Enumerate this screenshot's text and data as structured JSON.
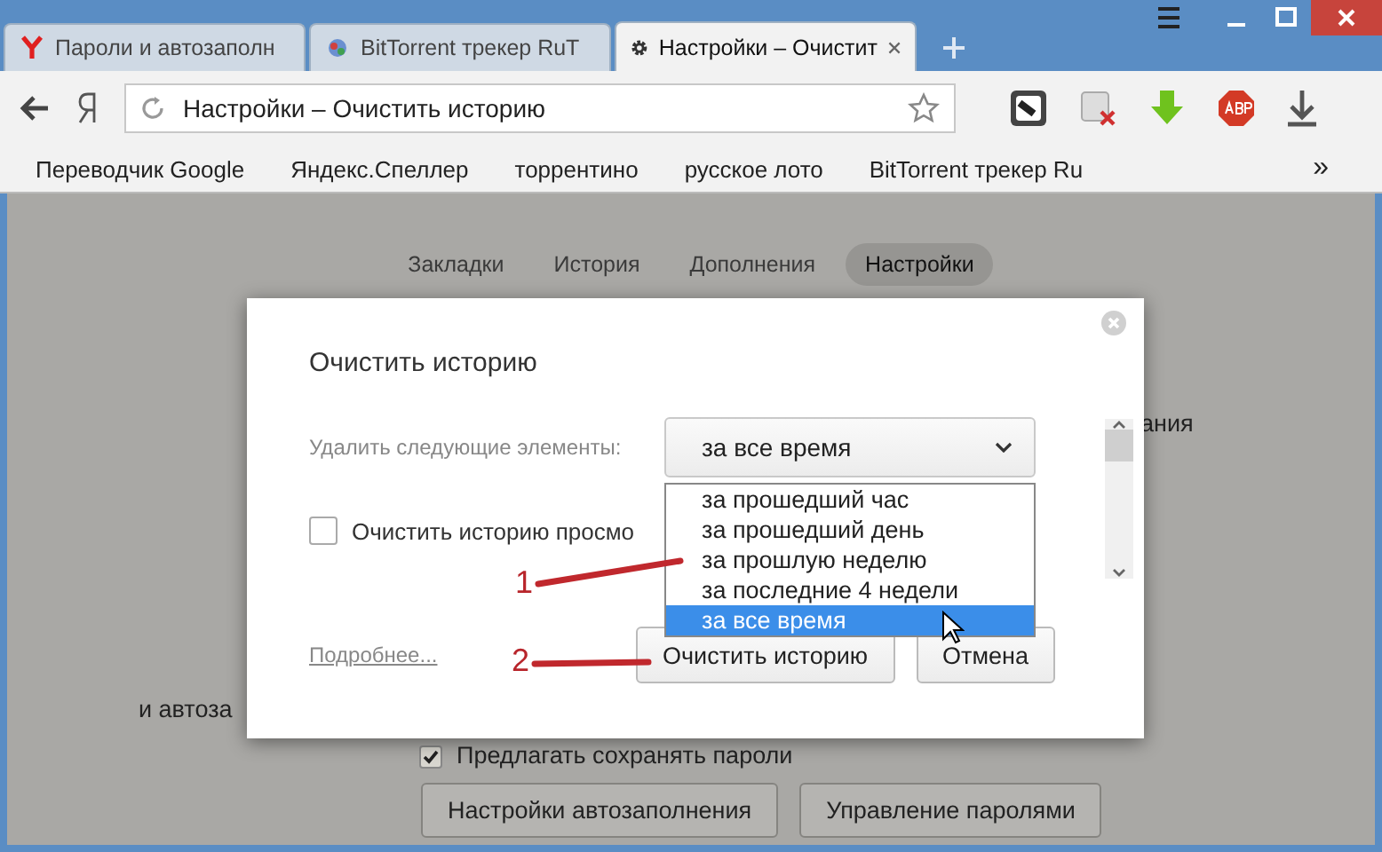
{
  "tabs": [
    {
      "title": "Пароли и автозаполн",
      "selected": false
    },
    {
      "title": "BitTorrent трекер RuT",
      "selected": false
    },
    {
      "title": "Настройки – Очистит",
      "selected": true
    }
  ],
  "address_bar": {
    "value": "Настройки – Очистить историю"
  },
  "bookmarks": [
    "Переводчик Google",
    "Яндекс.Спеллер",
    "торрентино",
    "русское лото",
    "BitTorrent трекер Ru"
  ],
  "bookmarks_overflow": "»",
  "page_nav": [
    {
      "label": "Закладки",
      "selected": false
    },
    {
      "label": "История",
      "selected": false
    },
    {
      "label": "Дополнения",
      "selected": false
    },
    {
      "label": "Настройки",
      "selected": true
    }
  ],
  "background": {
    "text_right": "ания",
    "text_left": "и автоза",
    "checkbox": {
      "label": "Предлагать сохранять пароли",
      "checked": true
    },
    "buttons": [
      "Настройки автозаполнения",
      "Управление паролями"
    ]
  },
  "dialog": {
    "title": "Очистить историю",
    "delete_label": "Удалить следующие элементы:",
    "select": {
      "value": "за все время",
      "options": [
        {
          "label": "за прошедший час",
          "selected": false
        },
        {
          "label": "за прошедший день",
          "selected": false
        },
        {
          "label": "за прошлую неделю",
          "selected": false
        },
        {
          "label": "за последние 4 недели",
          "selected": false
        },
        {
          "label": "за все время",
          "selected": true
        }
      ]
    },
    "checkbox": {
      "label": "Очистить историю просмо",
      "checked": false
    },
    "more_link": "Подробнее...",
    "buttons": [
      "Очистить историю",
      "Отмена"
    ]
  },
  "annotations": [
    "1",
    "2"
  ]
}
